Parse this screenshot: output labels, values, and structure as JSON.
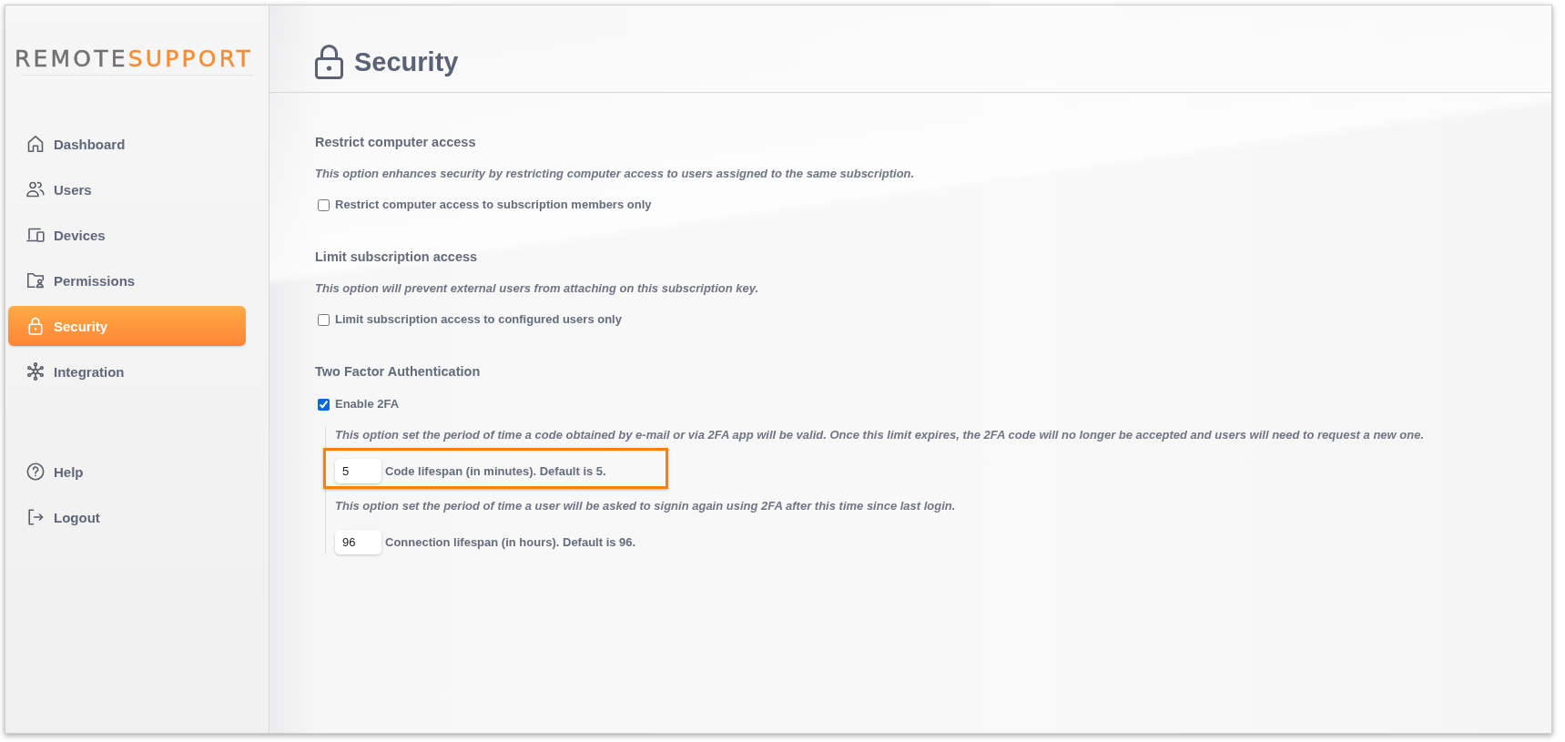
{
  "logo": [
    "REMOTE",
    "SUPPORT"
  ],
  "sidebar": {
    "items": [
      {
        "label": "Dashboard",
        "selected": false
      },
      {
        "label": "Users",
        "selected": false
      },
      {
        "label": "Devices",
        "selected": false
      },
      {
        "label": "Permissions",
        "selected": false
      },
      {
        "label": "Security",
        "selected": true
      },
      {
        "label": "Integration",
        "selected": false
      }
    ],
    "bottom_items": [
      {
        "label": "Help"
      },
      {
        "label": "Logout"
      }
    ]
  },
  "page": {
    "title": "Security"
  },
  "sections": [
    {
      "heading": "Restrict computer access",
      "description": "This option enhances security by restricting computer access to users assigned to the same subscription.",
      "checkbox": {
        "label": "Restrict computer access to subscription members only",
        "checked": false
      }
    },
    {
      "heading": "Limit subscription access",
      "description": "This option will prevent external users from attaching on this subscription key.",
      "checkbox": {
        "label": "Limit subscription access to configured users only",
        "checked": false
      }
    },
    {
      "heading": "Two Factor Authentication",
      "checkbox": {
        "label": "Enable 2FA",
        "checked": true
      },
      "settings": [
        {
          "description": "This option set the period of time a code obtained by e-mail or via 2FA app will be valid. Once this limit expires, the 2FA code will no longer be accepted and users will need to request a new one.",
          "value": "5",
          "label": "Code lifespan (in minutes). Default is 5.",
          "highlighted": true
        },
        {
          "description": "This option set the period of time a user will be asked to signin again using 2FA after this time since last login.",
          "value": "96",
          "label": "Connection lifespan (in hours). Default is 96.",
          "highlighted": false
        }
      ]
    }
  ]
}
